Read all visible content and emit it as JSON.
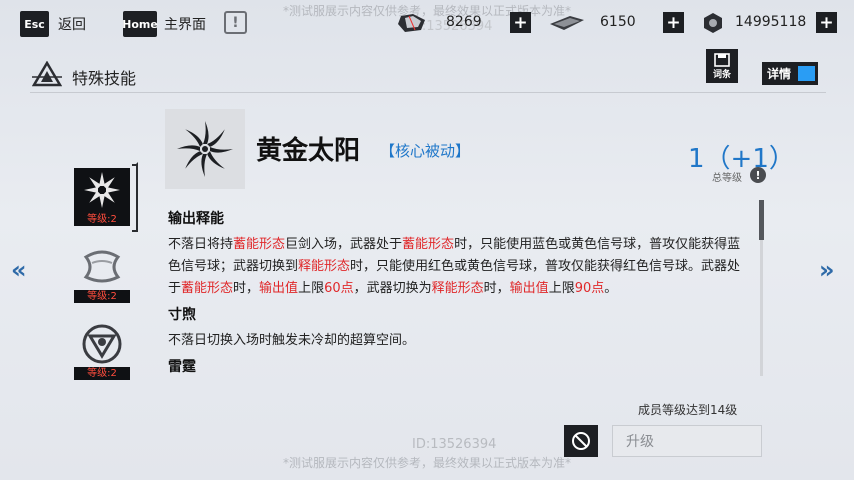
{
  "watermark": "*测试服展示内容仅供参考，最终效果以正式版本为准*",
  "id_text": "ID:13526394",
  "topbar": {
    "esc_key": "Esc",
    "back_label": "返回",
    "home_key": "Home",
    "home_label": "主界面",
    "alert_symbol": "!",
    "resources": [
      {
        "icon": "crystal-icon",
        "value": "8269",
        "plus": "+"
      },
      {
        "icon": "card-ticket-icon",
        "value": "6150",
        "plus": "+"
      },
      {
        "icon": "nut-currency-icon",
        "value": "14995118",
        "plus": "+"
      }
    ]
  },
  "section": {
    "title": "特殊技能",
    "entry_label": "词条",
    "detail_label": "详情",
    "detail_toggle_on": true
  },
  "skill_list": [
    {
      "icon": "sun-blade-icon",
      "level": "等级:2",
      "active": true
    },
    {
      "icon": "ribbon-icon",
      "level": "等级:2",
      "active": false
    },
    {
      "icon": "triangle-ring-icon",
      "level": "等级:2",
      "active": false
    }
  ],
  "skill": {
    "name": "黄金太阳",
    "type": "【核心被动】",
    "level": "1（+1）",
    "level_label": "总等级",
    "info_symbol": "!"
  },
  "description": {
    "sections": [
      {
        "title": "输出释能",
        "parts": [
          {
            "t": "不落日将持",
            "hl": false
          },
          {
            "t": "蓄能形态",
            "hl": true
          },
          {
            "t": "巨剑入场，武器处于",
            "hl": false
          },
          {
            "t": "蓄能形态",
            "hl": true
          },
          {
            "t": "时，只能使用蓝色或黄色信号球，普攻仅能获得蓝色信号球；武器切换到",
            "hl": false
          },
          {
            "t": "释能形态",
            "hl": true
          },
          {
            "t": "时，只能使用红色或黄色信号球，普攻仅能获得红色信号球。武器处于",
            "hl": false
          },
          {
            "t": "蓄能形态",
            "hl": true
          },
          {
            "t": "时，",
            "hl": false
          },
          {
            "t": "输出值",
            "hl": true
          },
          {
            "t": "上限",
            "hl": false
          },
          {
            "t": "60点",
            "hl": true
          },
          {
            "t": "，武器切换为",
            "hl": false
          },
          {
            "t": "释能形态",
            "hl": true
          },
          {
            "t": "时，",
            "hl": false
          },
          {
            "t": "输出值",
            "hl": true
          },
          {
            "t": "上限",
            "hl": false
          },
          {
            "t": "90点",
            "hl": true
          },
          {
            "t": "。",
            "hl": false
          }
        ]
      },
      {
        "title": "寸煦",
        "parts": [
          {
            "t": "不落日切换入场时触发未冷却的超算空间。",
            "hl": false
          }
        ]
      },
      {
        "title": "雷霆",
        "parts": []
      }
    ]
  },
  "requirement": "成员等级达到14级",
  "upgrade_label": "升级",
  "colors": {
    "accent_blue": "#2077c8",
    "highlight_red": "#e0282a",
    "dark": "#1d1f23"
  }
}
